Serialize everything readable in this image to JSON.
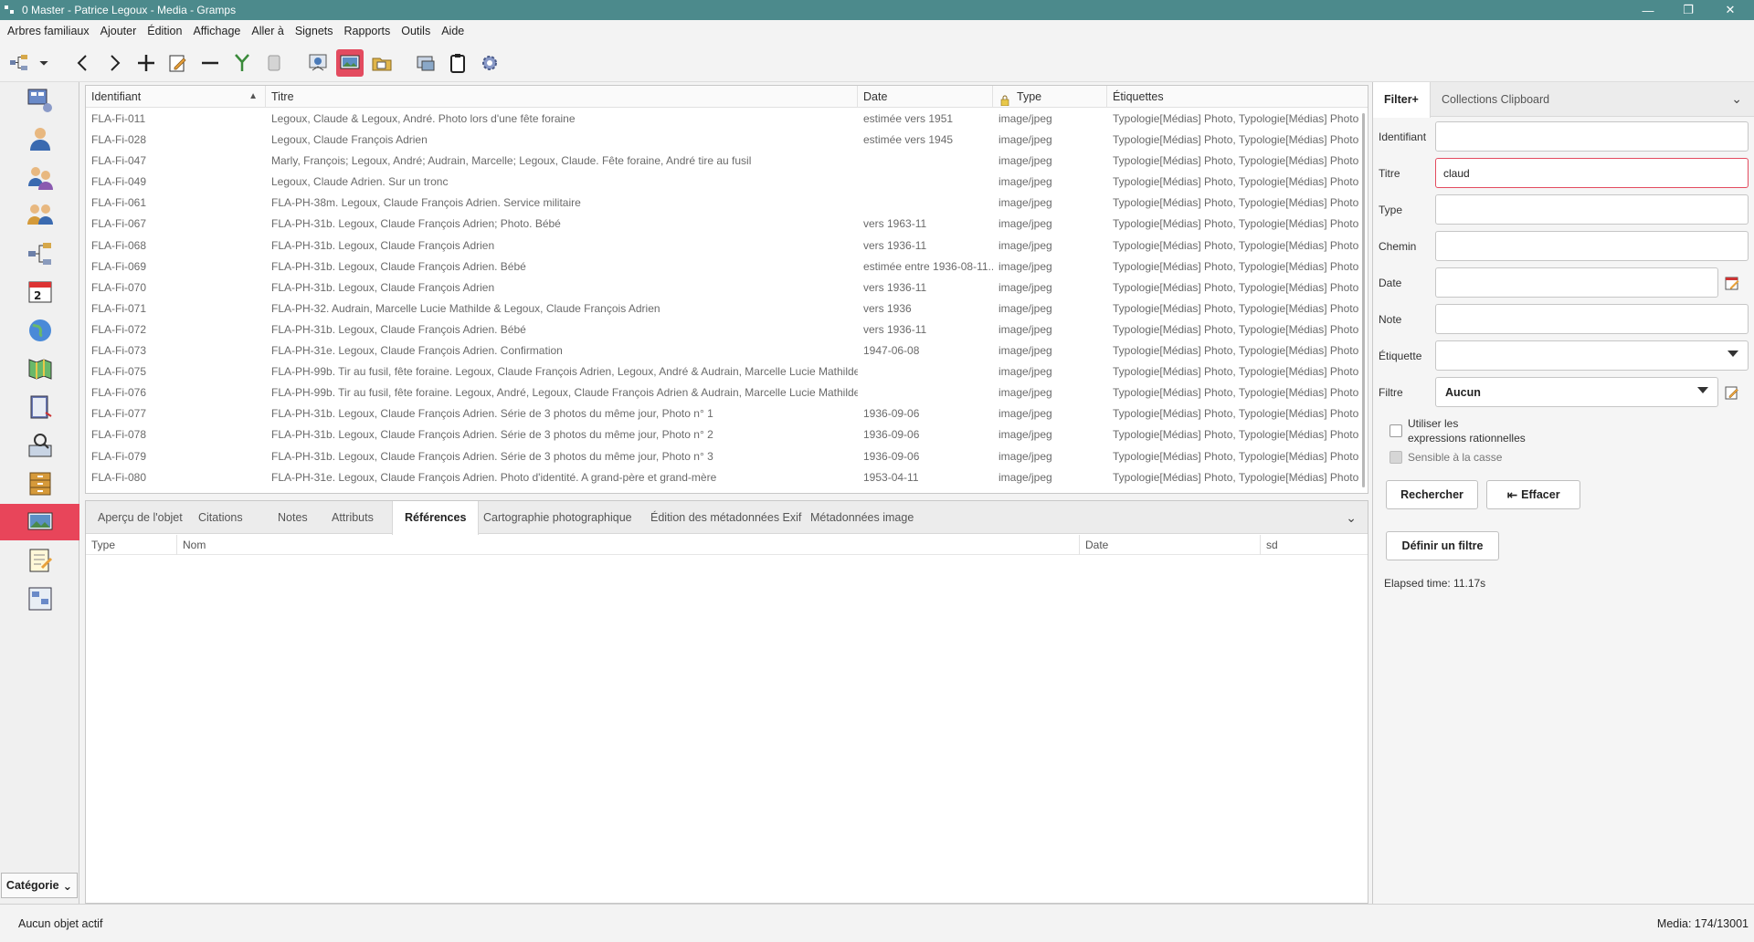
{
  "window": {
    "title": "0 Master - Patrice Legoux - Media - Gramps",
    "minimize": "—",
    "maximize": "❐",
    "close": "✕"
  },
  "menu": [
    "Arbres familiaux",
    "Ajouter",
    "Édition",
    "Affichage",
    "Aller à",
    "Signets",
    "Rapports",
    "Outils",
    "Aide"
  ],
  "toolbar": {
    "icons": [
      "tree-icon",
      "dropdown-arrow-icon",
      "back-icon",
      "forward-icon",
      "add-icon",
      "edit-icon",
      "remove-icon",
      "merge-icon",
      "bookmark-icon",
      "open-media-icon",
      "media-viewer-icon",
      "open-folder-icon",
      "media-manager-icon",
      "clipboard-icon",
      "preferences-icon"
    ],
    "active": "media-viewer-icon"
  },
  "sidebar": {
    "items": [
      "dashboard",
      "people",
      "relationships",
      "families",
      "charts",
      "events",
      "places",
      "geography",
      "sources",
      "citations",
      "repositories",
      "media",
      "notes",
      "gramplets"
    ],
    "active": "media",
    "category_label": "Catégorie"
  },
  "list": {
    "columns": [
      "Identifiant",
      "Titre",
      "Date",
      "Type",
      "Étiquettes"
    ],
    "sort_indicator": "▲",
    "rows": [
      {
        "id": "FLA-Fi-011",
        "title": "Legoux, Claude & Legoux, André. Photo lors d'une fête foraine",
        "date": "estimée vers 1951",
        "type": "image/jpeg",
        "tags": "Typologie[Médias] Photo, Typologie[Médias] Photo"
      },
      {
        "id": "FLA-Fi-028",
        "title": "Legoux, Claude François Adrien",
        "date": "estimée vers 1945",
        "type": "image/jpeg",
        "tags": "Typologie[Médias] Photo, Typologie[Médias] Photo"
      },
      {
        "id": "FLA-Fi-047",
        "title": "Marly, François; Legoux, André; Audrain, Marcelle; Legoux, Claude. Fête foraine, André tire au fusil",
        "date": "",
        "type": "image/jpeg",
        "tags": "Typologie[Médias] Photo, Typologie[Médias] Photo"
      },
      {
        "id": "FLA-Fi-049",
        "title": "Legoux, Claude Adrien. Sur un tronc",
        "date": "",
        "type": "image/jpeg",
        "tags": "Typologie[Médias] Photo, Typologie[Médias] Photo"
      },
      {
        "id": "FLA-Fi-061",
        "title": "FLA-PH-38m. Legoux, Claude François Adrien. Service militaire",
        "date": "",
        "type": "image/jpeg",
        "tags": "Typologie[Médias] Photo, Typologie[Médias] Photo"
      },
      {
        "id": "FLA-Fi-067",
        "title": "FLA-PH-31b. Legoux, Claude François Adrien; Photo. Bébé",
        "date": "vers 1963-11",
        "type": "image/jpeg",
        "tags": "Typologie[Médias] Photo, Typologie[Médias] Photo"
      },
      {
        "id": "FLA-Fi-068",
        "title": "FLA-PH-31b. Legoux, Claude François Adrien",
        "date": "vers 1936-11",
        "type": "image/jpeg",
        "tags": "Typologie[Médias] Photo, Typologie[Médias] Photo"
      },
      {
        "id": "FLA-Fi-069",
        "title": "FLA-PH-31b. Legoux, Claude François Adrien. Bébé",
        "date": "estimée entre 1936-08-11...",
        "type": "image/jpeg",
        "tags": "Typologie[Médias] Photo, Typologie[Médias] Photo"
      },
      {
        "id": "FLA-Fi-070",
        "title": "FLA-PH-31b. Legoux, Claude François Adrien",
        "date": "vers 1936-11",
        "type": "image/jpeg",
        "tags": "Typologie[Médias] Photo, Typologie[Médias] Photo"
      },
      {
        "id": "FLA-Fi-071",
        "title": "FLA-PH-32. Audrain, Marcelle Lucie Mathilde & Legoux, Claude François Adrien",
        "date": "vers 1936",
        "type": "image/jpeg",
        "tags": "Typologie[Médias] Photo, Typologie[Médias] Photo"
      },
      {
        "id": "FLA-Fi-072",
        "title": "FLA-PH-31b. Legoux, Claude François Adrien. Bébé",
        "date": "vers 1936-11",
        "type": "image/jpeg",
        "tags": "Typologie[Médias] Photo, Typologie[Médias] Photo"
      },
      {
        "id": "FLA-Fi-073",
        "title": "FLA-PH-31e. Legoux, Claude François Adrien. Confirmation",
        "date": "1947-06-08",
        "type": "image/jpeg",
        "tags": "Typologie[Médias] Photo, Typologie[Médias] Photo"
      },
      {
        "id": "FLA-Fi-075",
        "title": "FLA-PH-99b. Tir au fusil, fête foraine. Legoux, Claude François Adrien, Legoux, André & Audrain, Marcelle Lucie Mathilde",
        "date": "",
        "type": "image/jpeg",
        "tags": "Typologie[Médias] Photo, Typologie[Médias] Photo"
      },
      {
        "id": "FLA-Fi-076",
        "title": "FLA-PH-99b. Tir au fusil, fête foraine. Legoux, André, Legoux, Claude François Adrien & Audrain, Marcelle Lucie Mathilde",
        "date": "",
        "type": "image/jpeg",
        "tags": "Typologie[Médias] Photo, Typologie[Médias] Photo"
      },
      {
        "id": "FLA-Fi-077",
        "title": "FLA-PH-31b. Legoux, Claude François Adrien. Série de 3 photos du même jour, Photo n° 1",
        "date": "1936-09-06",
        "type": "image/jpeg",
        "tags": "Typologie[Médias] Photo, Typologie[Médias] Photo"
      },
      {
        "id": "FLA-Fi-078",
        "title": "FLA-PH-31b. Legoux, Claude François Adrien. Série de 3 photos du même jour, Photo n° 2",
        "date": "1936-09-06",
        "type": "image/jpeg",
        "tags": "Typologie[Médias] Photo, Typologie[Médias] Photo"
      },
      {
        "id": "FLA-Fi-079",
        "title": "FLA-PH-31b. Legoux, Claude François Adrien. Série de 3 photos du même jour, Photo n° 3",
        "date": "1936-09-06",
        "type": "image/jpeg",
        "tags": "Typologie[Médias] Photo, Typologie[Médias] Photo"
      },
      {
        "id": "FLA-Fi-080",
        "title": "FLA-PH-31e. Legoux, Claude François Adrien. Photo d'identité. A grand-père et grand-mère",
        "date": "1953-04-11",
        "type": "image/jpeg",
        "tags": "Typologie[Médias] Photo, Typologie[Médias] Photo"
      }
    ]
  },
  "bottom": {
    "tabs": [
      "Aperçu de l'objet",
      "Citations",
      "Notes",
      "Attributs",
      "Références",
      "Cartographie photographique",
      "Édition des métadonnées Exif",
      "Métadonnées image"
    ],
    "active_tab": "Références",
    "columns": [
      "Type",
      "Nom",
      "Date",
      "sd"
    ]
  },
  "filter": {
    "tabs": [
      "Filter+",
      "Collections Clipboard"
    ],
    "labels": {
      "id": "Identifiant",
      "title": "Titre",
      "type": "Type",
      "path": "Chemin",
      "date": "Date",
      "note": "Note",
      "tag": "Étiquette",
      "filter": "Filtre"
    },
    "values": {
      "id": "",
      "title": "claud",
      "type": "",
      "path": "",
      "date": "",
      "note": "",
      "tag": "",
      "filter": "Aucun"
    },
    "regex_label_1": "Utiliser les",
    "regex_label_2": "expressions rationnelles",
    "case_label": "Sensible à la casse",
    "search_button": "Rechercher",
    "clear_button": "Effacer",
    "define_button": "Définir un filtre",
    "elapsed": "Elapsed time: 11.17s"
  },
  "status": {
    "left": "Aucun objet actif",
    "right": "Media: 174/13001"
  },
  "colors": {
    "titlebar": "#4c8a8c",
    "accent": "#e8455a"
  }
}
